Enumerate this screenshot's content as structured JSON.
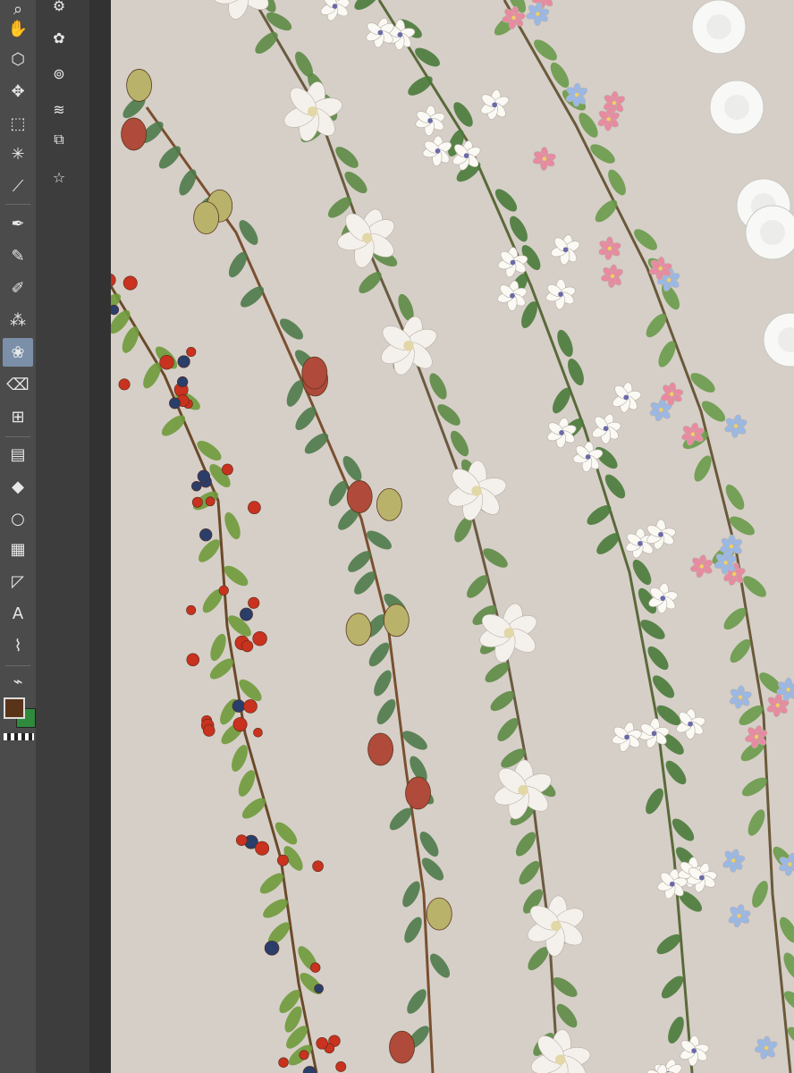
{
  "app": {
    "name": ""
  },
  "toolbar": {
    "tools": [
      {
        "icon": "zoom-icon",
        "glyph": "⌕"
      },
      {
        "icon": "hand-icon",
        "glyph": "✋"
      },
      {
        "icon": "3d-cube-icon",
        "glyph": "⬡"
      },
      {
        "icon": "move-icon",
        "glyph": "✥"
      },
      {
        "icon": "marquee-icon",
        "glyph": "⬚"
      },
      {
        "icon": "magic-wand-icon",
        "glyph": "✳"
      },
      {
        "icon": "eyedropper-icon",
        "glyph": "⟋"
      },
      {
        "icon": "pen-icon",
        "glyph": "✒"
      },
      {
        "icon": "pencil-icon",
        "glyph": "✎"
      },
      {
        "icon": "brush-icon",
        "glyph": "✐"
      },
      {
        "icon": "spray-icon",
        "glyph": "⁂"
      },
      {
        "icon": "decoration-icon",
        "glyph": "❀"
      },
      {
        "icon": "eraser-icon",
        "glyph": "⌫"
      },
      {
        "icon": "mesh-icon",
        "glyph": "⊞"
      },
      {
        "icon": "gradient-icon",
        "glyph": "▤"
      },
      {
        "icon": "fill-icon",
        "glyph": "◆"
      },
      {
        "icon": "ellipse-icon",
        "glyph": "○"
      },
      {
        "icon": "frame-icon",
        "glyph": "▦"
      },
      {
        "icon": "ruler-icon",
        "glyph": "◸"
      },
      {
        "icon": "text-icon",
        "glyph": "A"
      },
      {
        "icon": "lasso-icon",
        "glyph": "⌇"
      },
      {
        "icon": "correction-icon",
        "glyph": "⌁"
      }
    ],
    "active_tool": "decoration-icon",
    "foreground_color": "#5a3418",
    "background_color": "#2f8a3c"
  },
  "panel": {
    "tools": [
      {
        "icon": "sub-tool-settings-icon",
        "glyph": "⚙"
      },
      {
        "icon": "sub-tool-effects-icon",
        "glyph": "✿"
      },
      {
        "icon": "navigator-icon",
        "glyph": "⊚"
      },
      {
        "icon": "layer-icon",
        "glyph": "≋"
      },
      {
        "icon": "layer-property-icon",
        "glyph": "⧉"
      },
      {
        "icon": "material-icon",
        "glyph": "☆"
      }
    ]
  },
  "canvas": {
    "background": "#d6cfc8"
  }
}
